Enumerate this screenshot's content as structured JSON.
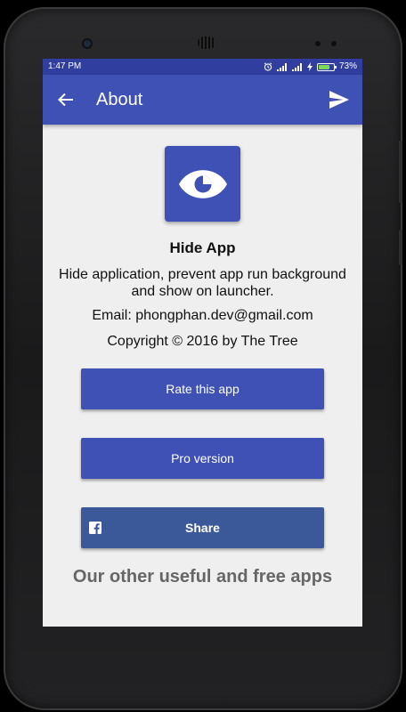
{
  "status_bar": {
    "time": "1:47 PM",
    "battery": "73%",
    "battery_level": 0.73
  },
  "app_bar": {
    "title": "About"
  },
  "about": {
    "app_name": "Hide App",
    "description": "Hide application, prevent app run background and show on launcher.",
    "email": "Email: phongphan.dev@gmail.com",
    "copyright": "Copyright © 2016 by The Tree"
  },
  "buttons": {
    "rate": "Rate this app",
    "pro": "Pro version",
    "share": "Share"
  },
  "other_apps_heading": "Our other useful and free apps",
  "colors": {
    "primary": "#3f51b5",
    "primary_dark": "#303f9f",
    "facebook": "#3b5998",
    "background": "#efefef"
  },
  "icons": [
    "arrow-back-icon",
    "send-icon",
    "eye-icon",
    "facebook-icon",
    "alarm-icon",
    "signal-icon",
    "charging-icon",
    "battery-icon"
  ]
}
